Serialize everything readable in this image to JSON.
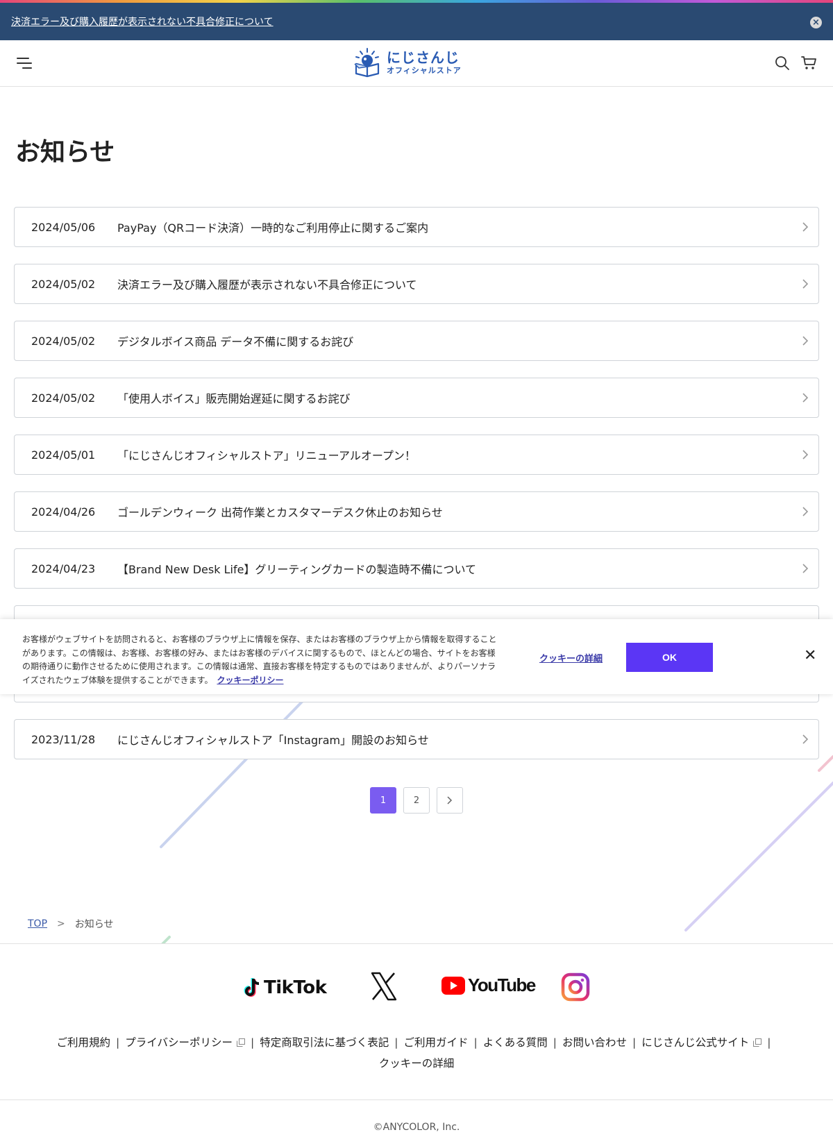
{
  "banner": {
    "link_text": "決済エラー及び購入履歴が表示されない不具合修正について",
    "close_label": "×"
  },
  "header": {
    "logo_main": "にじさんじ",
    "logo_sub": "オフィシャルストア"
  },
  "page": {
    "title": "お知らせ"
  },
  "news": [
    {
      "date": "2024/05/06",
      "title": "PayPay（QRコード決済）一時的なご利用停止に関するご案内"
    },
    {
      "date": "2024/05/02",
      "title": "決済エラー及び購入履歴が表示されない不具合修正について"
    },
    {
      "date": "2024/05/02",
      "title": "デジタルボイス商品 データ不備に関するお詫び"
    },
    {
      "date": "2024/05/02",
      "title": "「使用人ボイス」販売開始遅延に関するお詫び"
    },
    {
      "date": "2024/05/01",
      "title": "「にじさんじオフィシャルストア」リニューアルオープン！"
    },
    {
      "date": "2024/04/26",
      "title": "ゴールデンウィーク 出荷作業とカスタマーデスク休止のお知らせ"
    },
    {
      "date": "2024/04/23",
      "title": "【Brand New Desk Life】グリーティングカードの製造時不備について"
    },
    {
      "date": "",
      "title": ""
    },
    {
      "date": "",
      "title": ""
    },
    {
      "date": "2023/11/28",
      "title": "にじさんじオフィシャルストア「Instagram」開設のお知らせ"
    }
  ],
  "cookie": {
    "text": "お客様がウェブサイトを訪問されると、お客様のブラウザ上に情報を保存、またはお客様のブラウザ上から情報を取得することがあります。この情報は、お客様、お客様の好み、またはお客様のデバイスに関するもので、ほとんどの場合、サイトをお客様の期待通りに動作させるために使用されます。この情報は通常、直接お客様を特定するものではありませんが、よりパーソナライズされたウェブ体験を提供することができます。",
    "policy_link": "クッキーポリシー",
    "details_link": "クッキーの詳細",
    "ok_label": "OK",
    "close_label": "✕"
  },
  "pagination": {
    "pages": [
      "1",
      "2"
    ],
    "current": "1"
  },
  "breadcrumb": {
    "top": "TOP",
    "separator": ">",
    "current": "お知らせ"
  },
  "footer": {
    "social": {
      "tiktok": "TikTok",
      "youtube": "YouTube"
    },
    "links": {
      "terms": "ご利用規約",
      "privacy": "プライバシーポリシー",
      "commerce": "特定商取引法に基づく表記",
      "guide": "ご利用ガイド",
      "faq": "よくある質問",
      "contact": "お問い合わせ",
      "official": "にじさんじ公式サイト",
      "cookie": "クッキーの詳細"
    },
    "separator": "|",
    "copyright": "©ANYCOLOR, Inc."
  },
  "colors": {
    "banner_bg": "#2a4a72",
    "accent_purple": "#5b36f5",
    "page_active": "#7a5cf0",
    "logo_blue": "#2a5bb3"
  }
}
